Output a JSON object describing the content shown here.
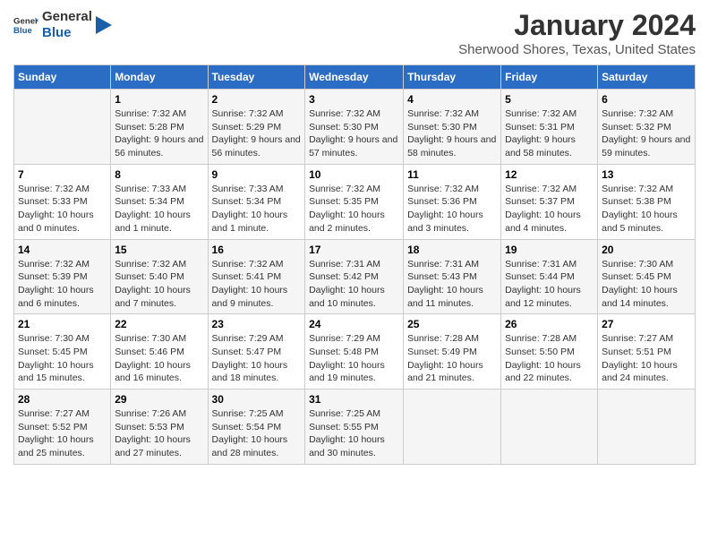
{
  "logo": {
    "text_general": "General",
    "text_blue": "Blue"
  },
  "header": {
    "title": "January 2024",
    "subtitle": "Sherwood Shores, Texas, United States"
  },
  "weekdays": [
    "Sunday",
    "Monday",
    "Tuesday",
    "Wednesday",
    "Thursday",
    "Friday",
    "Saturday"
  ],
  "weeks": [
    [
      {
        "day": "",
        "sunrise": "",
        "sunset": "",
        "daylight": ""
      },
      {
        "day": "1",
        "sunrise": "7:32 AM",
        "sunset": "5:28 PM",
        "daylight": "9 hours and 56 minutes."
      },
      {
        "day": "2",
        "sunrise": "7:32 AM",
        "sunset": "5:29 PM",
        "daylight": "9 hours and 56 minutes."
      },
      {
        "day": "3",
        "sunrise": "7:32 AM",
        "sunset": "5:30 PM",
        "daylight": "9 hours and 57 minutes."
      },
      {
        "day": "4",
        "sunrise": "7:32 AM",
        "sunset": "5:30 PM",
        "daylight": "9 hours and 58 minutes."
      },
      {
        "day": "5",
        "sunrise": "7:32 AM",
        "sunset": "5:31 PM",
        "daylight": "9 hours and 58 minutes."
      },
      {
        "day": "6",
        "sunrise": "7:32 AM",
        "sunset": "5:32 PM",
        "daylight": "9 hours and 59 minutes."
      }
    ],
    [
      {
        "day": "7",
        "sunrise": "7:32 AM",
        "sunset": "5:33 PM",
        "daylight": "10 hours and 0 minutes."
      },
      {
        "day": "8",
        "sunrise": "7:33 AM",
        "sunset": "5:34 PM",
        "daylight": "10 hours and 1 minute."
      },
      {
        "day": "9",
        "sunrise": "7:33 AM",
        "sunset": "5:34 PM",
        "daylight": "10 hours and 1 minute."
      },
      {
        "day": "10",
        "sunrise": "7:32 AM",
        "sunset": "5:35 PM",
        "daylight": "10 hours and 2 minutes."
      },
      {
        "day": "11",
        "sunrise": "7:32 AM",
        "sunset": "5:36 PM",
        "daylight": "10 hours and 3 minutes."
      },
      {
        "day": "12",
        "sunrise": "7:32 AM",
        "sunset": "5:37 PM",
        "daylight": "10 hours and 4 minutes."
      },
      {
        "day": "13",
        "sunrise": "7:32 AM",
        "sunset": "5:38 PM",
        "daylight": "10 hours and 5 minutes."
      }
    ],
    [
      {
        "day": "14",
        "sunrise": "7:32 AM",
        "sunset": "5:39 PM",
        "daylight": "10 hours and 6 minutes."
      },
      {
        "day": "15",
        "sunrise": "7:32 AM",
        "sunset": "5:40 PM",
        "daylight": "10 hours and 7 minutes."
      },
      {
        "day": "16",
        "sunrise": "7:32 AM",
        "sunset": "5:41 PM",
        "daylight": "10 hours and 9 minutes."
      },
      {
        "day": "17",
        "sunrise": "7:31 AM",
        "sunset": "5:42 PM",
        "daylight": "10 hours and 10 minutes."
      },
      {
        "day": "18",
        "sunrise": "7:31 AM",
        "sunset": "5:43 PM",
        "daylight": "10 hours and 11 minutes."
      },
      {
        "day": "19",
        "sunrise": "7:31 AM",
        "sunset": "5:44 PM",
        "daylight": "10 hours and 12 minutes."
      },
      {
        "day": "20",
        "sunrise": "7:30 AM",
        "sunset": "5:45 PM",
        "daylight": "10 hours and 14 minutes."
      }
    ],
    [
      {
        "day": "21",
        "sunrise": "7:30 AM",
        "sunset": "5:45 PM",
        "daylight": "10 hours and 15 minutes."
      },
      {
        "day": "22",
        "sunrise": "7:30 AM",
        "sunset": "5:46 PM",
        "daylight": "10 hours and 16 minutes."
      },
      {
        "day": "23",
        "sunrise": "7:29 AM",
        "sunset": "5:47 PM",
        "daylight": "10 hours and 18 minutes."
      },
      {
        "day": "24",
        "sunrise": "7:29 AM",
        "sunset": "5:48 PM",
        "daylight": "10 hours and 19 minutes."
      },
      {
        "day": "25",
        "sunrise": "7:28 AM",
        "sunset": "5:49 PM",
        "daylight": "10 hours and 21 minutes."
      },
      {
        "day": "26",
        "sunrise": "7:28 AM",
        "sunset": "5:50 PM",
        "daylight": "10 hours and 22 minutes."
      },
      {
        "day": "27",
        "sunrise": "7:27 AM",
        "sunset": "5:51 PM",
        "daylight": "10 hours and 24 minutes."
      }
    ],
    [
      {
        "day": "28",
        "sunrise": "7:27 AM",
        "sunset": "5:52 PM",
        "daylight": "10 hours and 25 minutes."
      },
      {
        "day": "29",
        "sunrise": "7:26 AM",
        "sunset": "5:53 PM",
        "daylight": "10 hours and 27 minutes."
      },
      {
        "day": "30",
        "sunrise": "7:25 AM",
        "sunset": "5:54 PM",
        "daylight": "10 hours and 28 minutes."
      },
      {
        "day": "31",
        "sunrise": "7:25 AM",
        "sunset": "5:55 PM",
        "daylight": "10 hours and 30 minutes."
      },
      {
        "day": "",
        "sunrise": "",
        "sunset": "",
        "daylight": ""
      },
      {
        "day": "",
        "sunrise": "",
        "sunset": "",
        "daylight": ""
      },
      {
        "day": "",
        "sunrise": "",
        "sunset": "",
        "daylight": ""
      }
    ]
  ],
  "labels": {
    "sunrise_prefix": "Sunrise: ",
    "sunset_prefix": "Sunset: ",
    "daylight_prefix": "Daylight: "
  }
}
